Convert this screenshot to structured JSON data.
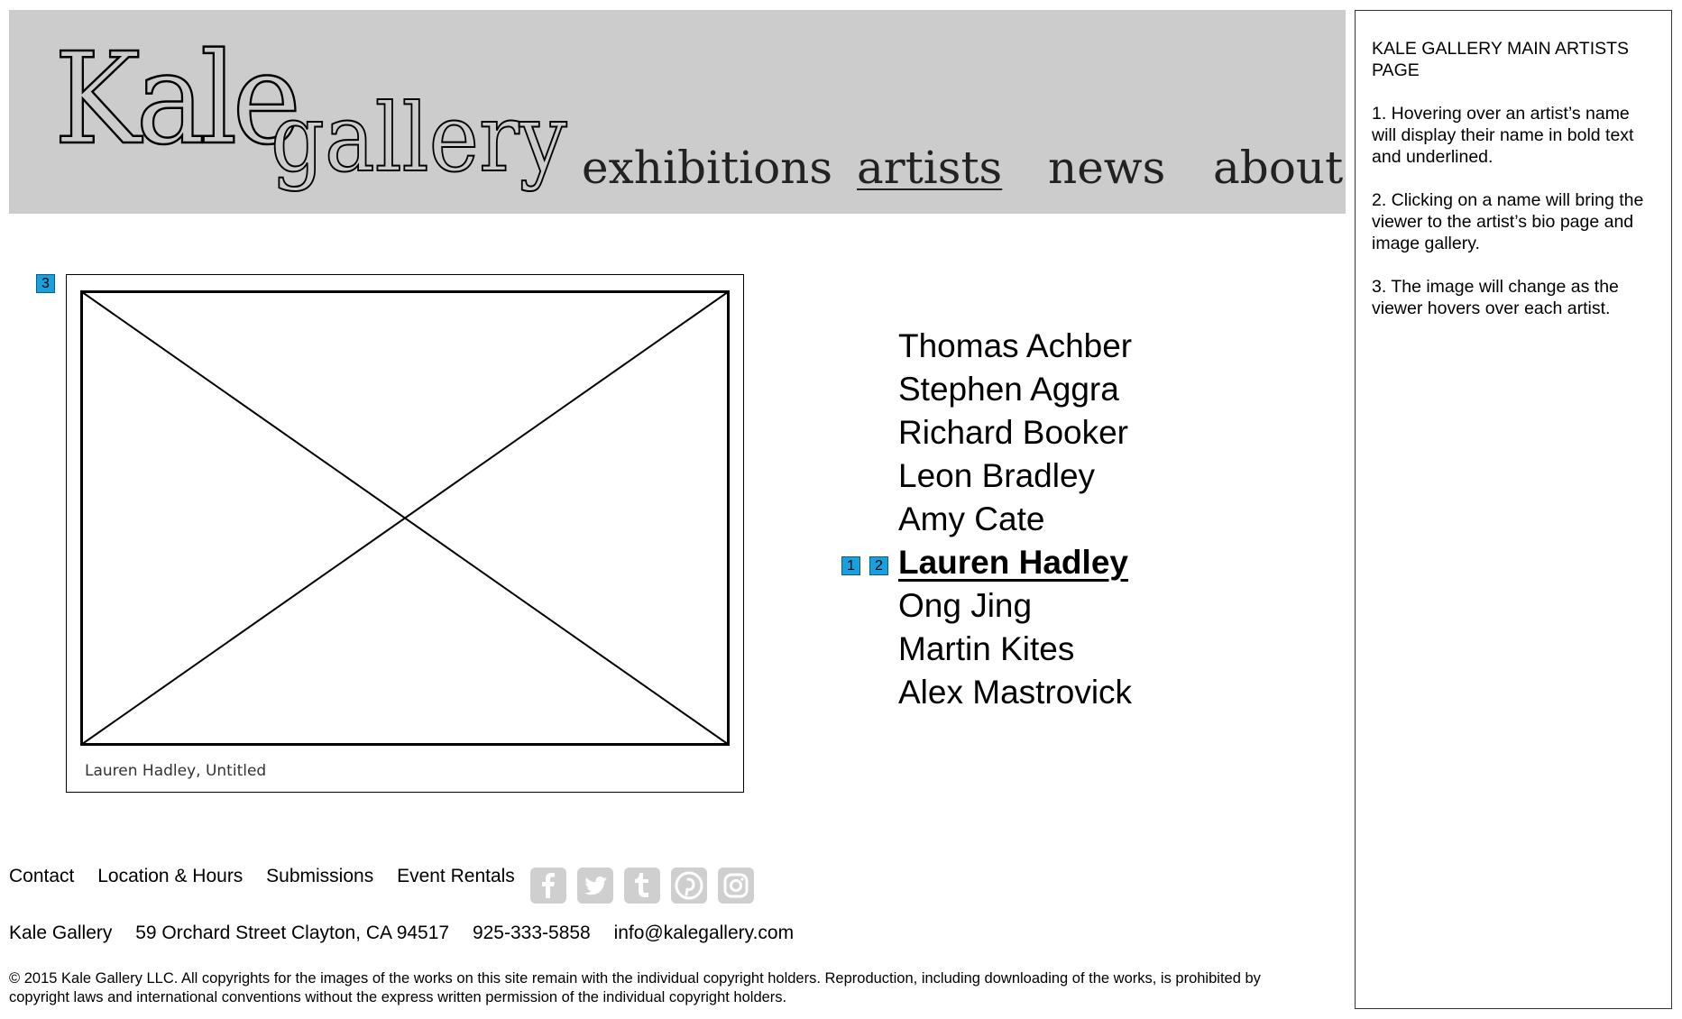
{
  "logo": {
    "word1": "Kale",
    "word2": "gallery"
  },
  "nav": [
    {
      "label": "exhibitions"
    },
    {
      "label": "artists"
    },
    {
      "label": "news"
    },
    {
      "label": "about"
    }
  ],
  "featured_image": {
    "caption": "Lauren Hadley, Untitled"
  },
  "artists": [
    "Thomas Achber",
    "Stephen Aggra",
    "Richard Booker",
    "Leon Bradley",
    "Amy Cate",
    "Lauren Hadley",
    "Ong Jing",
    "Martin Kites",
    "Alex Mastrovick"
  ],
  "markers": {
    "image": "3",
    "hover": "1",
    "click": "2"
  },
  "footer": {
    "links": [
      "Contact",
      "Location & Hours",
      "Submissions",
      "Event Rentals"
    ],
    "social_icons": [
      "facebook-icon",
      "twitter-icon",
      "tumblr-icon",
      "pinterest-icon",
      "instagram-icon"
    ],
    "contact": {
      "name": "Kale Gallery",
      "address": "59 Orchard Street Clayton, CA 94517",
      "phone": "925-333-5858",
      "email": "info@kalegallery.com"
    },
    "copyright": "© 2015 Kale Gallery LLC. All copyrights for the images of the works on this site remain with the individual copyright holders. Reproduction, including downloading of the works, is prohibited by copyright laws and international conventions without the express written permission of the individual copyright holders."
  },
  "annotations": {
    "title": "KALE GALLERY MAIN ARTISTS PAGE",
    "notes": [
      "1. Hovering over an artist’s name will display their name in bold text and underlined.",
      "2. Clicking on a name will bring the viewer to the artist’s bio page and image gallery.",
      "3. The image will change as the viewer hovers over each artist."
    ]
  },
  "colors": {
    "header_bg": "#cccccc",
    "marker": "#1a9fdf",
    "social_icon": "#cfcfcf"
  }
}
